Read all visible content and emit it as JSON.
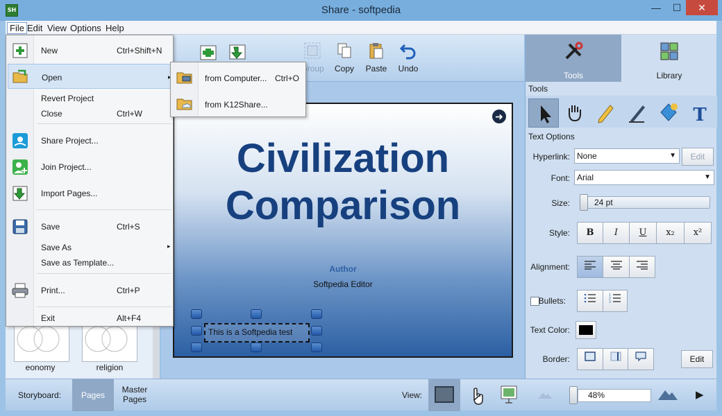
{
  "window": {
    "title": "Share - softpedia",
    "app_icon_text": "SH",
    "minimize": "—",
    "maximize": "☐",
    "close": "✕"
  },
  "menubar": {
    "items": [
      "File",
      "Edit",
      "View",
      "Options",
      "Help"
    ]
  },
  "toolbar": {
    "group": "Group",
    "copy": "Copy",
    "paste": "Paste",
    "undo": "Undo"
  },
  "file_menu": {
    "new": {
      "label": "New",
      "shortcut": "Ctrl+Shift+N"
    },
    "open": {
      "label": "Open",
      "arrow": "▸"
    },
    "revert": {
      "label": "Revert Project"
    },
    "close": {
      "label": "Close",
      "shortcut": "Ctrl+W"
    },
    "share": {
      "label": "Share Project..."
    },
    "join": {
      "label": "Join Project..."
    },
    "import": {
      "label": "Import Pages..."
    },
    "save": {
      "label": "Save",
      "shortcut": "Ctrl+S"
    },
    "save_as": {
      "label": "Save As",
      "arrow": "▸"
    },
    "save_template": {
      "label": "Save as Template..."
    },
    "print": {
      "label": "Print...",
      "shortcut": "Ctrl+P"
    },
    "exit": {
      "label": "Exit",
      "shortcut": "Alt+F4"
    }
  },
  "open_submenu": {
    "from_computer": {
      "label": "from Computer...",
      "shortcut": "Ctrl+O"
    },
    "from_k12share": {
      "label": "from K12Share..."
    }
  },
  "slide": {
    "title": "Civilization Comparison",
    "author_label": "Author",
    "author": "Softpedia Editor",
    "textbox": "This is a Softpedia test",
    "nav_arrow": "➜"
  },
  "pages_panel": {
    "thumbs": [
      "eonomy",
      "religion"
    ]
  },
  "bottombar": {
    "storyboard": "Storyboard:",
    "pages": "Pages",
    "master_pages": "Master Pages",
    "view": "View:",
    "zoom": "48%",
    "play": "▶"
  },
  "right_panel": {
    "tabs": {
      "tools": "Tools",
      "library": "Library"
    },
    "tools_title": "Tools",
    "text_options_title": "Text Options",
    "hyperlink": {
      "label": "Hyperlink:",
      "value": "None",
      "edit": "Edit"
    },
    "font": {
      "label": "Font:",
      "value": "Arial"
    },
    "size": {
      "label": "Size:",
      "value": "24 pt"
    },
    "style": {
      "label": "Style:",
      "bold": "B",
      "italic": "I",
      "underline": "U",
      "subscript": "x₂",
      "superscript": "x²"
    },
    "alignment": {
      "label": "Alignment:"
    },
    "bullets": {
      "label": "Bullets:"
    },
    "text_color": {
      "label": "Text Color:",
      "value": "#000000"
    },
    "border": {
      "label": "Border:",
      "edit": "Edit"
    }
  },
  "colors": {
    "accent": "#77aede",
    "close": "#c74a3f",
    "slide_title": "#17407f"
  }
}
